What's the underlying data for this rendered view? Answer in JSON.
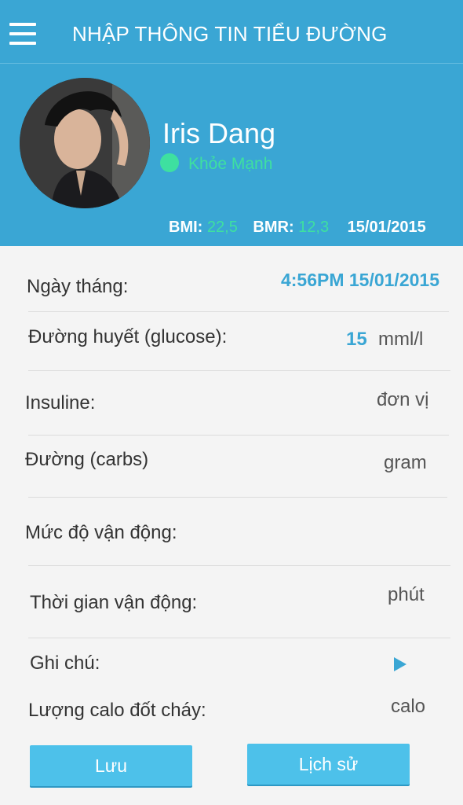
{
  "header": {
    "title": "NHẬP THÔNG TIN TIỂU ĐƯỜNG",
    "menu_icon": "hamburger-menu-icon"
  },
  "profile": {
    "name": "Iris Dang",
    "status": "Khỏe Mạnh",
    "bmi_label": "BMI:",
    "bmi_value": "22,5",
    "bmr_label": "BMR:",
    "bmr_value": "12,3",
    "date": "15/01/2015"
  },
  "form": {
    "date_label": "Ngày tháng:",
    "date_value": "4:56PM 15/01/2015",
    "glucose_label": "Đường huyết (glucose):",
    "glucose_value": "15",
    "glucose_unit": "mml/l",
    "insulin_label": "Insuline:",
    "insulin_unit": "đơn vị",
    "carbs_label": "Đường (carbs)",
    "carbs_unit": "gram",
    "activity_level_label": "Mức độ vận động:",
    "activity_time_label": "Thời gian vận động:",
    "activity_time_unit": "phút",
    "note_label": "Ghi chú:",
    "calories_label": "Lượng calo đốt cháy:",
    "calories_unit": "calo"
  },
  "actions": {
    "save_label": "Lưu",
    "history_label": "Lịch sử"
  },
  "colors": {
    "primary": "#3aa6d4",
    "accent": "#3ee0a0",
    "button": "#4dc1ea"
  }
}
